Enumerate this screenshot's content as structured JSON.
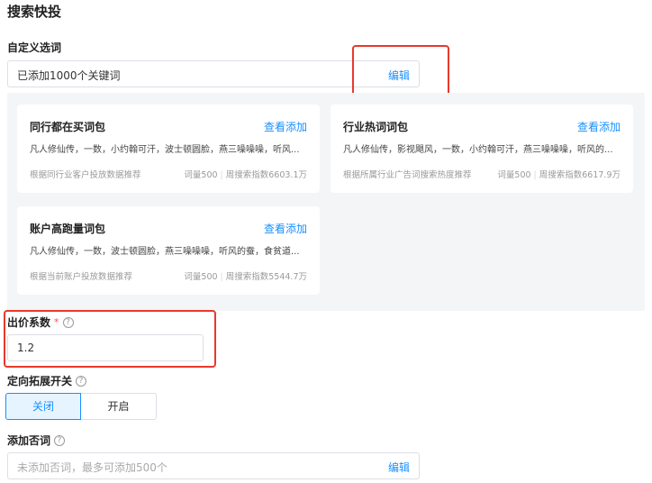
{
  "section_title": "搜索快投",
  "custom_keywords": {
    "label": "自定义选词",
    "value": "已添加1000个关键词",
    "edit_label": "编辑"
  },
  "packages": [
    {
      "title": "同行都在买词包",
      "link": "查看添加",
      "words": "凡人修仙传，一数，小约翰可汗，波士顿圆脸，燕三噪噪噪，听风...",
      "source": "根据同行业客户投放数据推荐",
      "volume": "词量500",
      "index": "周搜索指数6603.1万"
    },
    {
      "title": "行业热词词包",
      "link": "查看添加",
      "words": "凡人修仙传，影视飓风，一数，小约翰可汗，燕三噪噪噪，听风的...",
      "source": "根据所属行业广告词搜索热度推荐",
      "volume": "词量500",
      "index": "周搜索指数6617.9万"
    },
    {
      "title": "账户高跑量词包",
      "link": "查看添加",
      "words": "凡人修仙传，一数，波士顿圆脸，燕三噪噪噪，听风的蚕，食贫道...",
      "source": "根据当前账户投放数据推荐",
      "volume": "词量500",
      "index": "周搜索指数5544.7万"
    }
  ],
  "bid": {
    "label": "出价系数",
    "required_mark": "*",
    "value": "1.2"
  },
  "targeting": {
    "label": "定向拓展开关",
    "off_label": "关闭",
    "on_label": "开启",
    "selected": "关闭"
  },
  "negative_keywords": {
    "label": "添加否词",
    "placeholder": "未添加否词，最多可添加500个",
    "edit_label": "编辑"
  },
  "colors": {
    "link": "#1890ff",
    "highlight": "#e8392c",
    "panel_bg": "#f4f5f7"
  }
}
